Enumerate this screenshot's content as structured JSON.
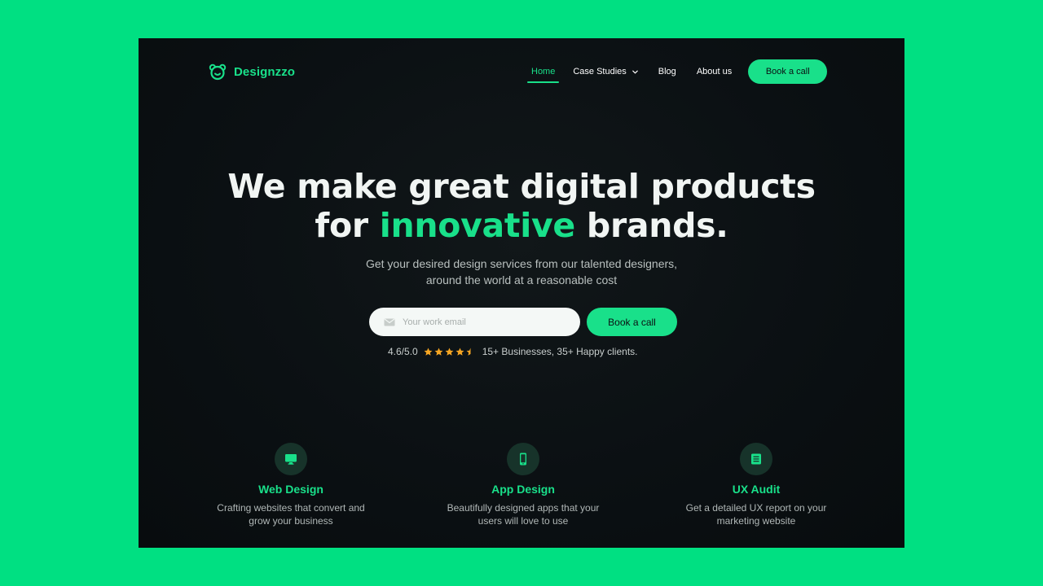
{
  "brand": {
    "name": "Designzzo",
    "accent": "#19e08a",
    "background": "#00e082"
  },
  "nav": {
    "items": [
      {
        "label": "Home",
        "active": true
      },
      {
        "label": "Case Studies",
        "has_dropdown": true
      },
      {
        "label": "Blog"
      },
      {
        "label": "About us"
      }
    ],
    "cta_label": "Book a call"
  },
  "hero": {
    "title_line1": "We make great digital products",
    "title_line2_prefix": "for ",
    "title_line2_accent": "innovative",
    "title_line2_suffix": " brands.",
    "subtitle_line1": "Get your desired design services from our talented designers,",
    "subtitle_line2": "around the world at a reasonable cost",
    "email_placeholder": "Your work email",
    "cta_label": "Book a call",
    "rating_value": "4.6/5.0",
    "rating_stars": 4.5,
    "clients_text": "15+ Businesses, 35+ Happy clients."
  },
  "features": [
    {
      "icon": "monitor-icon",
      "title": "Web Design",
      "desc_line1": "Crafting websites that convert and",
      "desc_line2": "grow your business"
    },
    {
      "icon": "smartphone-icon",
      "title": "App Design",
      "desc_line1": "Beautifully designed apps that your",
      "desc_line2": "users will love to use"
    },
    {
      "icon": "report-icon",
      "title": "UX Audit",
      "desc_line1": "Get a detailed UX report on your",
      "desc_line2": "marketing website"
    }
  ]
}
